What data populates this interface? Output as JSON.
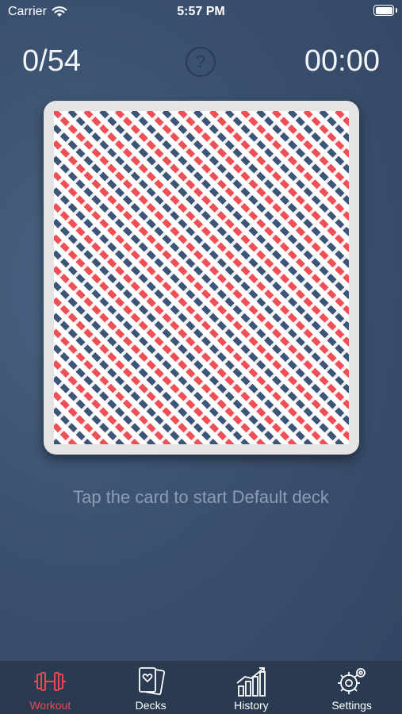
{
  "status_bar": {
    "carrier": "Carrier",
    "time": "5:57 PM"
  },
  "header": {
    "counter": "0/54",
    "help_symbol": "?",
    "timer": "00:00"
  },
  "card": {
    "pattern_colors": [
      "#3d5577",
      "#ef4f56",
      "#ffffff"
    ]
  },
  "hint": "Tap the card to start Default deck",
  "tab_bar": {
    "active_color": "#e84a4f",
    "tabs": [
      {
        "label": "Workout",
        "icon": "dumbbell-icon",
        "active": true
      },
      {
        "label": "Decks",
        "icon": "cards-icon",
        "active": false
      },
      {
        "label": "History",
        "icon": "chart-icon",
        "active": false
      },
      {
        "label": "Settings",
        "icon": "gear-icon",
        "active": false
      }
    ]
  }
}
